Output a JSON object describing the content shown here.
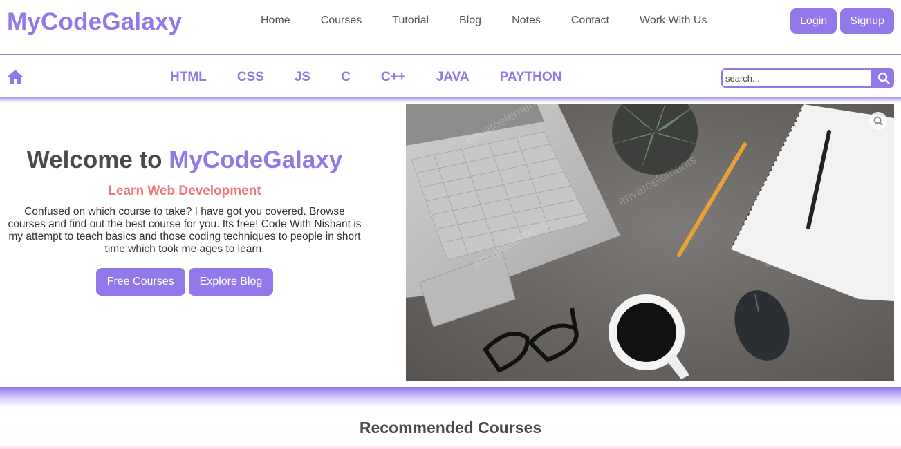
{
  "header": {
    "logo": "MyCodeGalaxy",
    "nav": [
      "Home",
      "Courses",
      "Tutorial",
      "Blog",
      "Notes",
      "Contact",
      "Work With Us"
    ],
    "login_label": "Login",
    "signup_label": "Signup"
  },
  "subnav": {
    "home_icon": "home-icon",
    "languages": [
      "HTML",
      "CSS",
      "JS",
      "C",
      "C++",
      "JAVA",
      "PAYTHON"
    ],
    "search_placeholder": "search...",
    "search_icon": "search-icon"
  },
  "hero": {
    "title_prefix": "Welcome to",
    "title_brand": "MyCodeGalaxy",
    "subtitle": "Learn Web Development",
    "description": "Confused on which course to take? I have got you covered. Browse courses and find out the best course for you. Its free! Code With Nishant is my attempt to teach basics and those coding techniques to people in short time which took me ages to learn.",
    "free_courses_label": "Free Courses",
    "explore_blog_label": "Explore Blog",
    "image_watermark": "envatoelements"
  },
  "recommended": {
    "title": "Recommended Courses"
  },
  "colors": {
    "accent": "#9278e8",
    "subtitle": "#ee7777",
    "text": "#4a4a4a"
  }
}
